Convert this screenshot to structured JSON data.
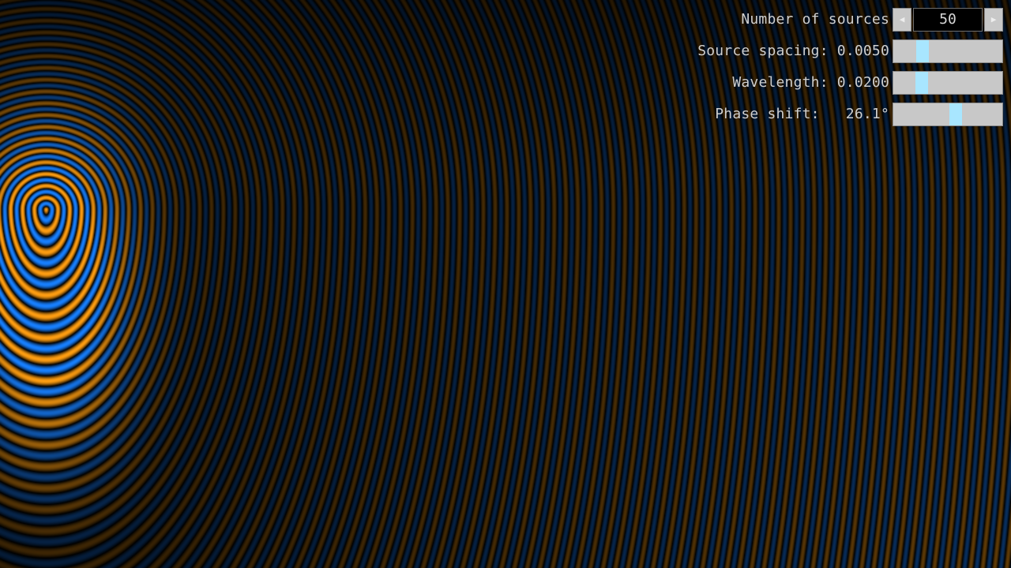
{
  "controls": {
    "sources": {
      "label": "Number of sources",
      "value": "50",
      "dec_icon": "triangle-left-icon",
      "inc_icon": "triangle-right-icon"
    },
    "spacing": {
      "label": "Source spacing: 0.0050",
      "level": 0.27
    },
    "wavelength": {
      "label": "Wavelength: 0.0200",
      "level": 0.26
    },
    "phase": {
      "label": "Phase shift:   26.1°",
      "level": 0.57
    }
  },
  "colors": {
    "background": "#000000",
    "wave_warm": "#ff9e12",
    "wave_cool": "#1880ff",
    "slider_track": "#c8c8c8",
    "slider_thumb": "#a8e6ff",
    "label_text": "#cfcfcf"
  }
}
